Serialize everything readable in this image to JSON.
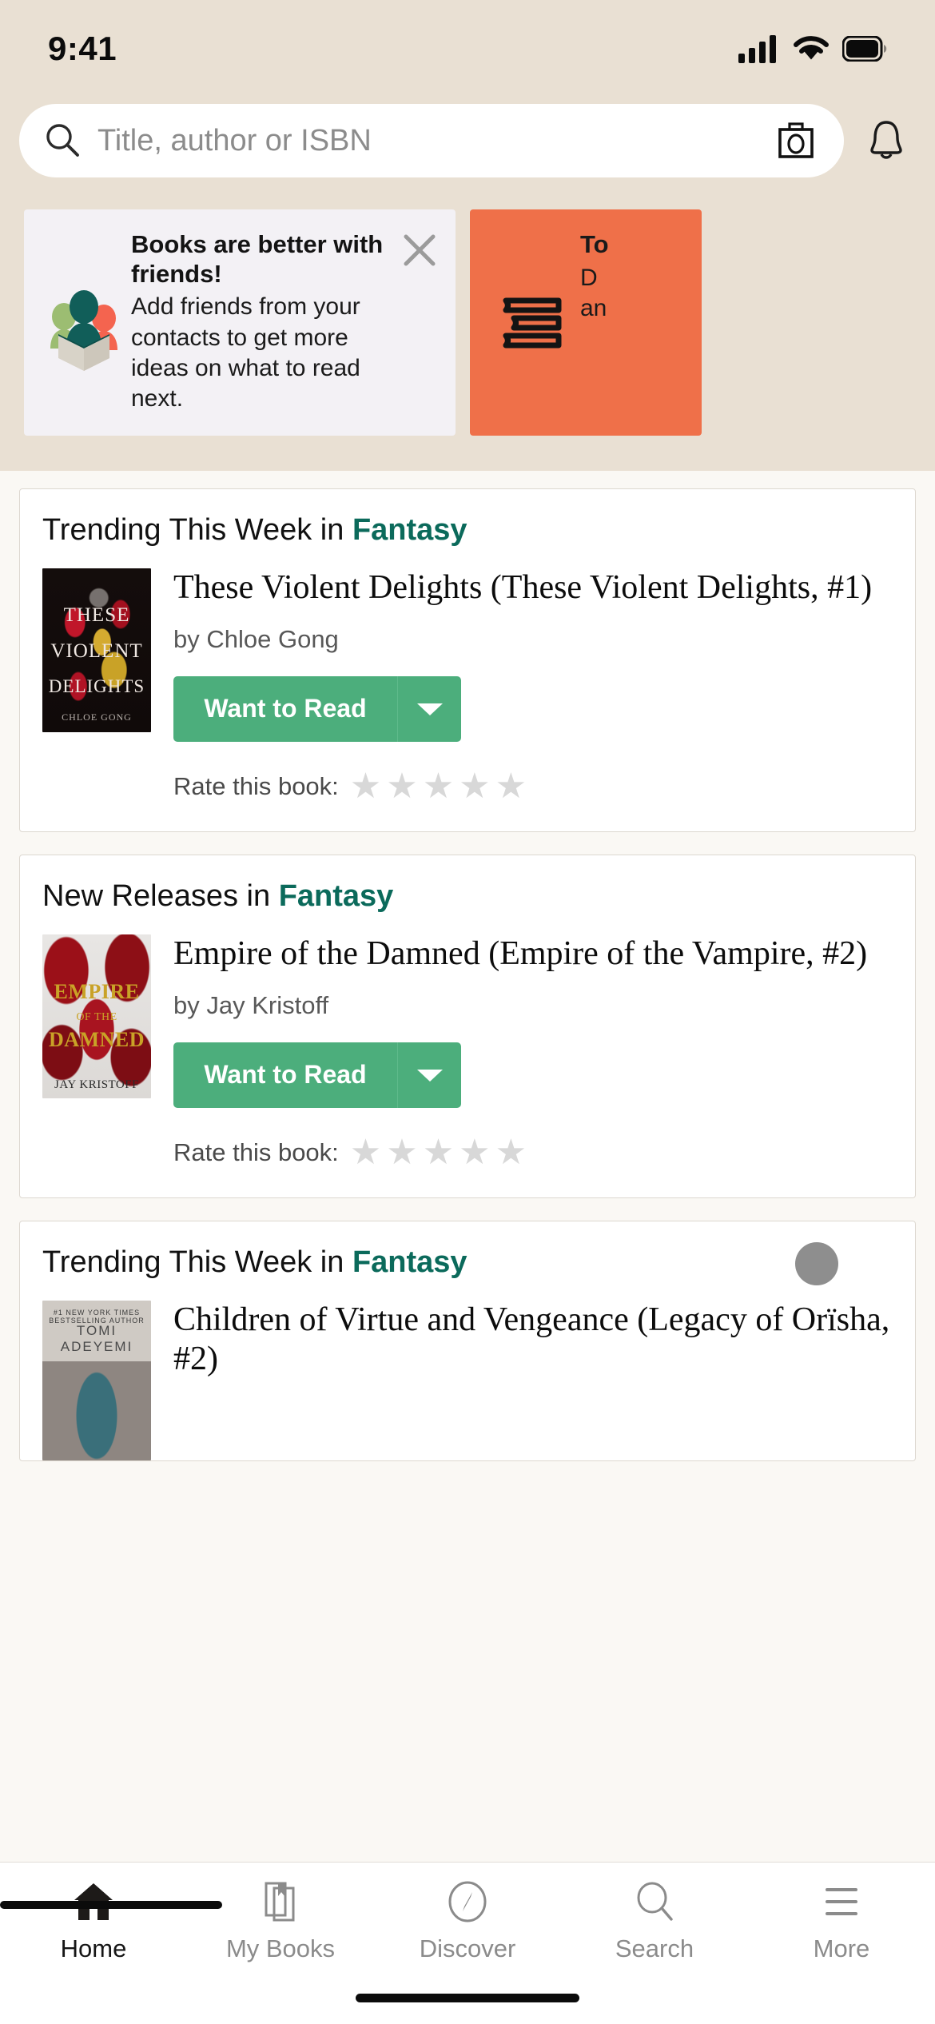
{
  "status_bar": {
    "time": "9:41",
    "cellular_icon": "cellular-signal-icon",
    "wifi_icon": "wifi-icon",
    "battery_icon": "battery-icon"
  },
  "search": {
    "placeholder": "Title, author or ISBN",
    "search_icon": "search-icon",
    "scan_icon": "camera-scan-icon",
    "bell_icon": "notification-bell-icon"
  },
  "banners": [
    {
      "id": "friends",
      "icon": "friends-group-icon",
      "title": "Books are better with friends!",
      "body": "Add friends from your contacts to get more ideas on what to read next.",
      "close_icon": "close-icon",
      "background": "#f3f1f5"
    },
    {
      "id": "want-to-read",
      "icon": "stacked-books-icon",
      "title": "To",
      "body_line1": "D",
      "body_line2": "an",
      "background": "#ef7049"
    }
  ],
  "feed": {
    "cards": [
      {
        "heading_prefix": "Trending This Week in ",
        "heading_genre": "Fantasy",
        "cover_text": {
          "line1": "THESE",
          "line2": "VIOLENT",
          "line3": "DELIGHTS",
          "author_line": "CHLOE GONG"
        },
        "title": "These Violent Delights (These Violent Delights, #1)",
        "author": "by Chloe Gong",
        "shelf_button": "Want to Read",
        "caret_icon": "chevron-down-icon",
        "rate_label": "Rate this book:",
        "stars": 5,
        "rating": 0,
        "has_avatar": false
      },
      {
        "heading_prefix": "New Releases in ",
        "heading_genre": "Fantasy",
        "cover_text": {
          "line1": "EMPIRE",
          "line2": "OF THE",
          "line3": "DAMNED",
          "author_line": "JAY KRISTOFF"
        },
        "title": "Empire of the Damned (Empire of the Vampire, #2)",
        "author": "by Jay Kristoff",
        "shelf_button": "Want to Read",
        "caret_icon": "chevron-down-icon",
        "rate_label": "Rate this book:",
        "stars": 5,
        "rating": 0,
        "has_avatar": false
      },
      {
        "heading_prefix": "Trending This Week in ",
        "heading_genre": "Fantasy",
        "cover_text": {
          "line1": "#1 NEW YORK TIMES BESTSELLING AUTHOR",
          "line2": "TOMI ADEYEMI",
          "line3": "",
          "author_line": ""
        },
        "title": "Children of Virtue and Vengeance (Legacy of Orïsha, #2)",
        "author": "",
        "shelf_button": "",
        "caret_icon": "",
        "rate_label": "",
        "stars": 0,
        "rating": 0,
        "has_avatar": true
      }
    ]
  },
  "tabbar": {
    "items": [
      {
        "label": "Home",
        "icon": "home-icon",
        "active": true
      },
      {
        "label": "My Books",
        "icon": "books-bookmark-icon",
        "active": false
      },
      {
        "label": "Discover",
        "icon": "compass-icon",
        "active": false
      },
      {
        "label": "Search",
        "icon": "search-icon",
        "active": false
      },
      {
        "label": "More",
        "icon": "hamburger-menu-icon",
        "active": false
      }
    ]
  },
  "colors": {
    "top_background": "#e9e0d3",
    "page_background": "#faf8f4",
    "card_background": "#ffffff",
    "genre_accent": "#0b6a5b",
    "shelf_button_green": "#4cae7c",
    "banner_orange": "#ef7049",
    "banner_gray": "#f3f1f5",
    "star_empty": "#d8d8d8"
  }
}
